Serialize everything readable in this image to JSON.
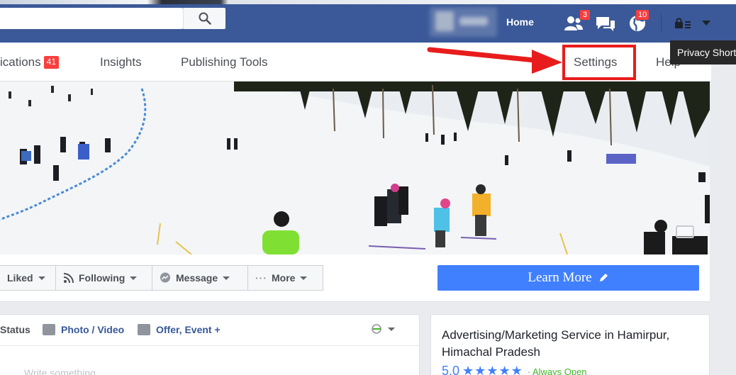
{
  "bluebar": {
    "search_value": "",
    "home_label": "Home",
    "friend_requests_count": "3",
    "notifications_count": "10",
    "icons": [
      "search-icon",
      "friends-icon",
      "messages-icon",
      "globe-icon",
      "privacy-lock-icon",
      "dropdown-icon"
    ]
  },
  "tooltip": {
    "text": "Privacy Shortcuts"
  },
  "pagenav": {
    "notifications_label": "ications",
    "notifications_badge": "41",
    "insights_label": "Insights",
    "publishing_tools_label": "Publishing Tools",
    "settings_label": "Settings",
    "help_label": "Help"
  },
  "actions": {
    "liked_label": "Liked",
    "following_label": "Following",
    "message_label": "Message",
    "more_label": "More",
    "learn_more_label": "Learn More"
  },
  "composer": {
    "status_label": "Status",
    "photo_video_label": "Photo / Video",
    "offer_event_label": "Offer, Event +",
    "placeholder": "Write something..."
  },
  "about": {
    "category": "Advertising/Marketing Service in Hamirpur, Himachal Pradesh",
    "rating": "5.0",
    "stars": "★★★★★",
    "hours": "· Always Open"
  },
  "colors": {
    "bluebar": "#3b5998",
    "badge": "#fa3e3e",
    "highlight": "#e81c1c",
    "learn_more": "#4080ff",
    "link": "#365899"
  }
}
